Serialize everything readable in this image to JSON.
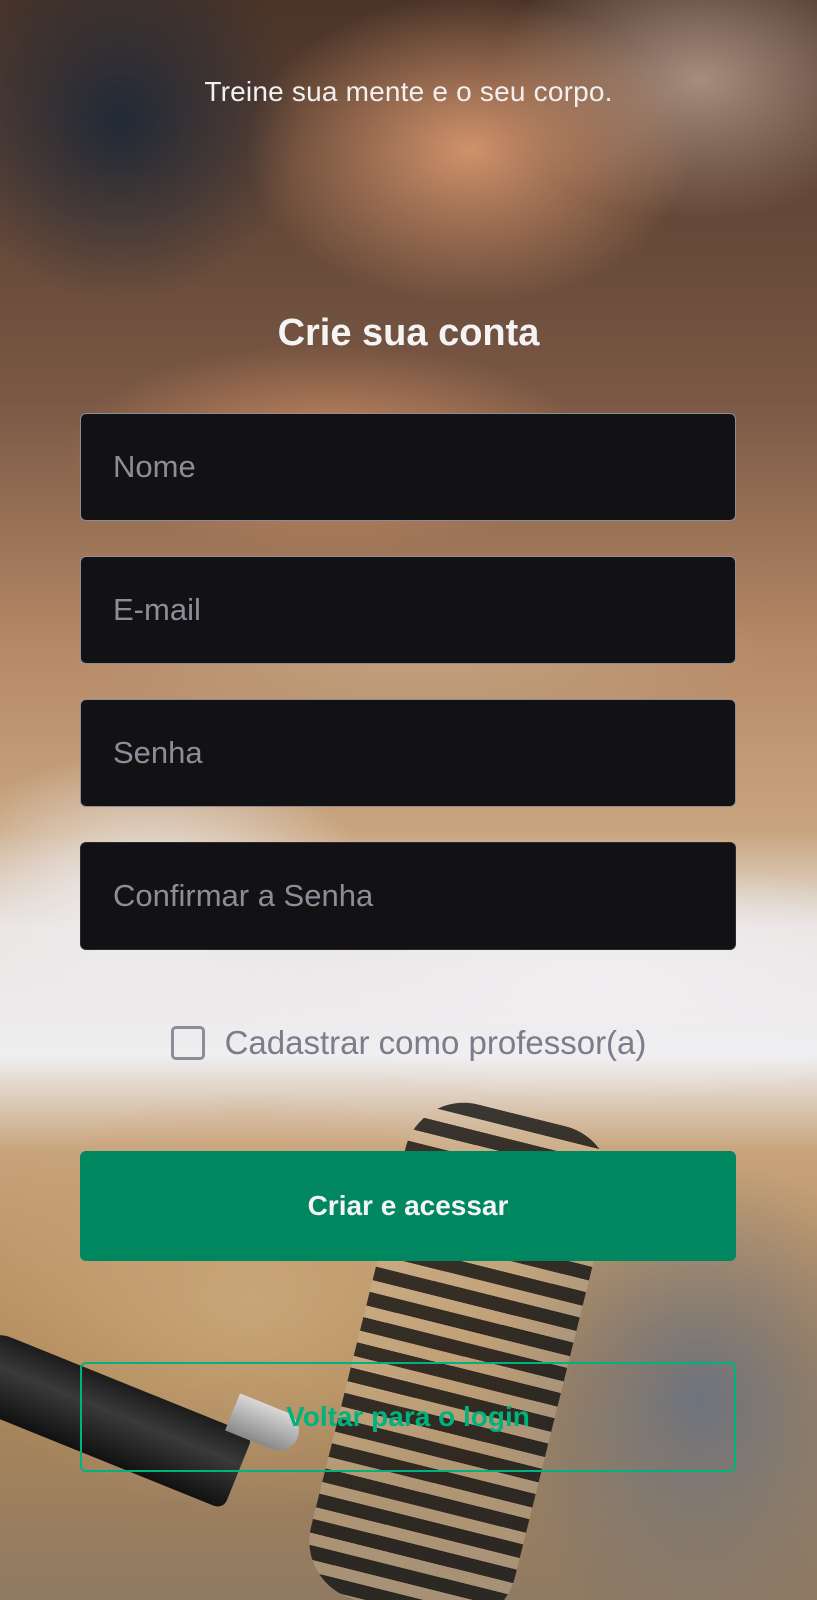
{
  "header": {
    "tagline": "Treine sua mente e o seu corpo."
  },
  "form": {
    "title": "Crie sua conta",
    "fields": [
      {
        "placeholder": "Nome",
        "value": ""
      },
      {
        "placeholder": "E-mail",
        "value": ""
      },
      {
        "placeholder": "Senha",
        "value": ""
      },
      {
        "placeholder": "Confirmar a Senha",
        "value": ""
      }
    ],
    "teacher_checkbox": {
      "label": "Cadastrar como professor(a)",
      "checked": false
    },
    "submit_label": "Criar e acessar",
    "back_label": "Voltar para o login"
  },
  "colors": {
    "primary": "#00875f",
    "secondary": "#00b37e",
    "input_bg": "#121214",
    "placeholder": "#8d8d99"
  }
}
